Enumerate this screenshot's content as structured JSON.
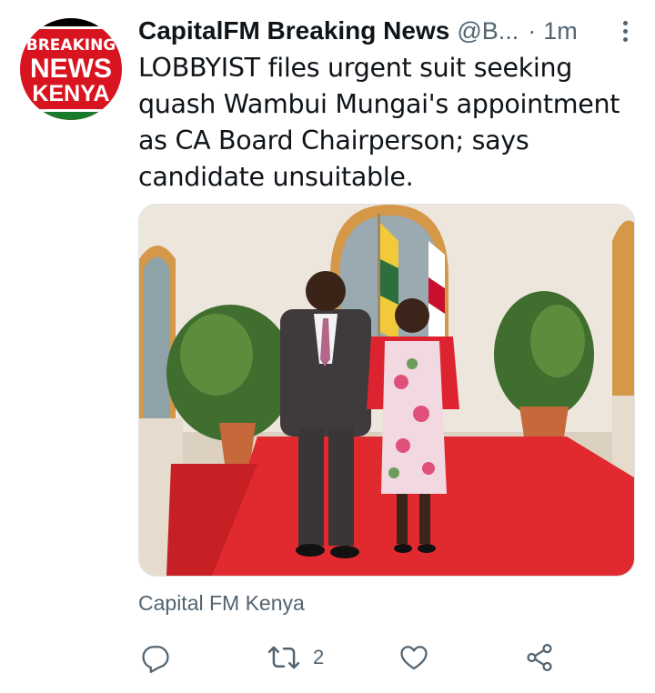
{
  "avatar": {
    "lines": [
      "BREAKING",
      "NEWS",
      "KENYA"
    ]
  },
  "tweet": {
    "display_name": "CapitalFM Breaking News",
    "handle": "@B...",
    "separator": "·",
    "time": "1m",
    "text": "LOBBYIST files urgent suit seeking quash Wambui Mungai's appointment as CA Board Chairperson; says candidate unsuitable."
  },
  "card": {
    "source": "Capital FM Kenya"
  },
  "actions": {
    "reply_icon": "reply-icon",
    "retweet_icon": "retweet-icon",
    "retweet_count": "2",
    "like_icon": "heart-icon",
    "share_icon": "share-icon"
  },
  "colors": {
    "avatar_red": "#d7141f",
    "name_text": "#0f1419",
    "secondary_text": "#536471",
    "carpet_red": "#e02a2f"
  }
}
